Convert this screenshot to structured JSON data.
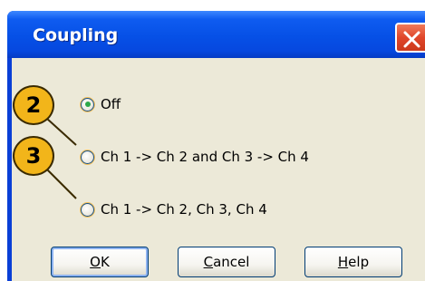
{
  "dialog": {
    "title": "Coupling"
  },
  "options": [
    {
      "label": "Off",
      "checked": true
    },
    {
      "label": "Ch 1 -> Ch 2 and Ch 3 -> Ch 4",
      "checked": false
    },
    {
      "label": "Ch 1 -> Ch 2, Ch 3, Ch 4",
      "checked": false
    }
  ],
  "buttons": {
    "ok": {
      "mnemonic": "O",
      "rest": "K"
    },
    "cancel": {
      "mnemonic": "C",
      "rest": "ancel"
    },
    "help": {
      "mnemonic": "H",
      "rest": "elp"
    }
  },
  "callouts": {
    "first": "2",
    "second": "3",
    "color": "#f2b51a"
  },
  "colors": {
    "titlebar": "#0650e6",
    "client": "#ece9d8",
    "close_button": "#e0462a",
    "radio_selected_dot": "#2da84a"
  }
}
